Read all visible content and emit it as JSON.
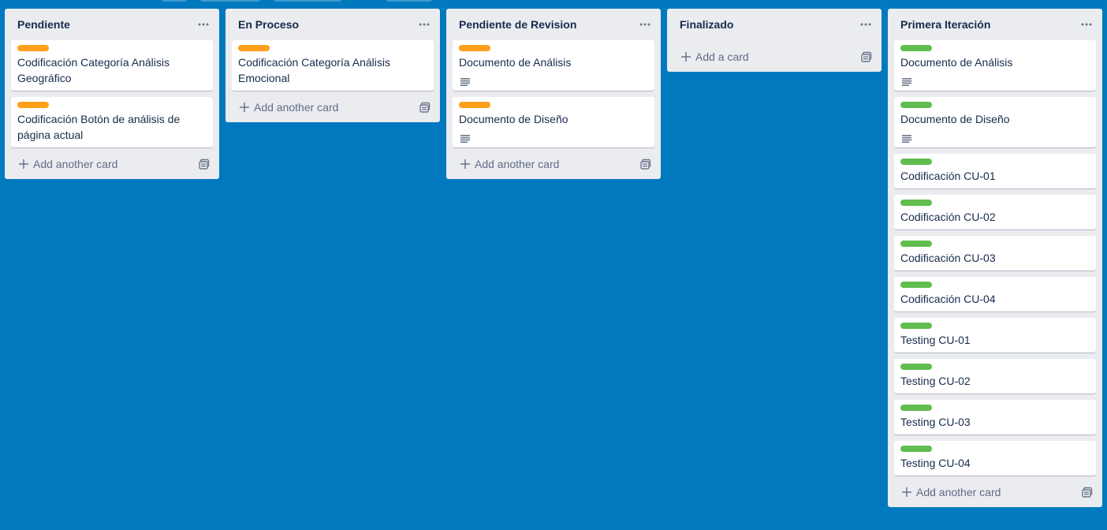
{
  "colors": {
    "board_bg": "#0079bf",
    "label_orange": "#ff9f1a",
    "label_green": "#61bd4f"
  },
  "icons": {
    "list_menu": "ellipsis-icon",
    "add": "plus-icon",
    "template": "card-template-icon",
    "description": "description-lines-icon"
  },
  "lists": [
    {
      "title": "Pendiente",
      "add_label": "Add another card",
      "cards": [
        {
          "label_color": "orange",
          "title": "Codificación Categoría Análisis Geográfico",
          "has_description": false
        },
        {
          "label_color": "orange",
          "title": "Codificación Botón de análisis de página actual",
          "has_description": false
        }
      ]
    },
    {
      "title": "En Proceso",
      "add_label": "Add another card",
      "cards": [
        {
          "label_color": "orange",
          "title": "Codificación Categoría Análisis Emocional",
          "has_description": false
        }
      ]
    },
    {
      "title": "Pendiente de Revision",
      "add_label": "Add another card",
      "cards": [
        {
          "label_color": "orange",
          "title": "Documento de Análisis",
          "has_description": true
        },
        {
          "label_color": "orange",
          "title": "Documento de Diseño",
          "has_description": true
        }
      ]
    },
    {
      "title": "Finalizado",
      "add_label": "Add a card",
      "cards": []
    },
    {
      "title": "Primera Iteración",
      "add_label": "Add another card",
      "cards": [
        {
          "label_color": "green",
          "title": "Documento de Análisis",
          "has_description": true
        },
        {
          "label_color": "green",
          "title": "Documento de Diseño",
          "has_description": true
        },
        {
          "label_color": "green",
          "title": "Codificación CU-01",
          "has_description": false
        },
        {
          "label_color": "green",
          "title": "Codificación CU-02",
          "has_description": false
        },
        {
          "label_color": "green",
          "title": "Codificación CU-03",
          "has_description": false
        },
        {
          "label_color": "green",
          "title": "Codificación CU-04",
          "has_description": false
        },
        {
          "label_color": "green",
          "title": "Testing CU-01",
          "has_description": false
        },
        {
          "label_color": "green",
          "title": "Testing CU-02",
          "has_description": false
        },
        {
          "label_color": "green",
          "title": "Testing CU-03",
          "has_description": false
        },
        {
          "label_color": "green",
          "title": "Testing CU-04",
          "has_description": false
        }
      ]
    }
  ]
}
